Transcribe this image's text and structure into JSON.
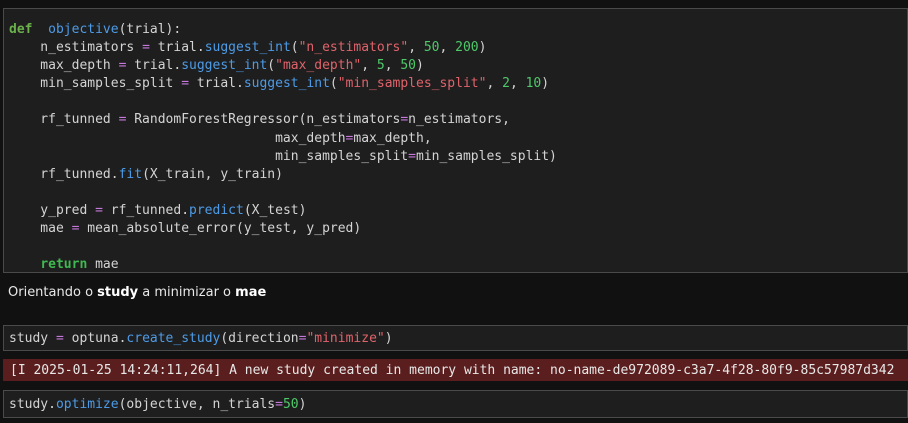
{
  "cell1": {
    "lines": [
      [
        [
          "kw-def",
          "def"
        ],
        [
          "",
          "  "
        ],
        [
          "fn",
          "objective"
        ],
        [
          "",
          "(trial):"
        ]
      ],
      [
        [
          "",
          "    n_estimators "
        ],
        [
          "op",
          "="
        ],
        [
          "",
          " trial."
        ],
        [
          "fn",
          "suggest_int"
        ],
        [
          "",
          "("
        ],
        [
          "str",
          "\"n_estimators\""
        ],
        [
          "",
          ", "
        ],
        [
          "num",
          "50"
        ],
        [
          "",
          ", "
        ],
        [
          "num",
          "200"
        ],
        [
          "",
          ")"
        ]
      ],
      [
        [
          "",
          "    max_depth "
        ],
        [
          "op",
          "="
        ],
        [
          "",
          " trial."
        ],
        [
          "fn",
          "suggest_int"
        ],
        [
          "",
          "("
        ],
        [
          "str",
          "\"max_depth\""
        ],
        [
          "",
          ", "
        ],
        [
          "num",
          "5"
        ],
        [
          "",
          ", "
        ],
        [
          "num",
          "50"
        ],
        [
          "",
          ")"
        ]
      ],
      [
        [
          "",
          "    min_samples_split "
        ],
        [
          "op",
          "="
        ],
        [
          "",
          " trial."
        ],
        [
          "fn",
          "suggest_int"
        ],
        [
          "",
          "("
        ],
        [
          "str",
          "\"min_samples_split\""
        ],
        [
          "",
          ", "
        ],
        [
          "num",
          "2"
        ],
        [
          "",
          ", "
        ],
        [
          "num",
          "10"
        ],
        [
          "",
          ")"
        ]
      ],
      [
        [
          "",
          ""
        ]
      ],
      [
        [
          "",
          "    rf_tunned "
        ],
        [
          "op",
          "="
        ],
        [
          "",
          " RandomForestRegressor(n_estimators"
        ],
        [
          "op",
          "="
        ],
        [
          "",
          "n_estimators,"
        ]
      ],
      [
        [
          "",
          "                                  max_depth"
        ],
        [
          "op",
          "="
        ],
        [
          "",
          "max_depth,"
        ]
      ],
      [
        [
          "",
          "                                  min_samples_split"
        ],
        [
          "op",
          "="
        ],
        [
          "",
          "min_samples_split)"
        ]
      ],
      [
        [
          "",
          "    rf_tunned."
        ],
        [
          "fn",
          "fit"
        ],
        [
          "",
          "(X_train, y_train)"
        ]
      ],
      [
        [
          "",
          ""
        ]
      ],
      [
        [
          "",
          "    y_pred "
        ],
        [
          "op",
          "="
        ],
        [
          "",
          " rf_tunned."
        ],
        [
          "fn",
          "predict"
        ],
        [
          "",
          "(X_test)"
        ]
      ],
      [
        [
          "",
          "    mae "
        ],
        [
          "op",
          "="
        ],
        [
          "",
          " mean_absolute_error(y_test, y_pred)"
        ]
      ],
      [
        [
          "",
          ""
        ]
      ],
      [
        [
          "",
          "    "
        ],
        [
          "kw-ret",
          "return"
        ],
        [
          "",
          " mae"
        ]
      ]
    ]
  },
  "markdown": {
    "prefix": "Orientando o ",
    "bold1": "study",
    "middle": " a minimizar o ",
    "bold2": "mae"
  },
  "cell2": {
    "lines": [
      [
        [
          "",
          "study "
        ],
        [
          "op",
          "="
        ],
        [
          "",
          " optuna."
        ],
        [
          "fn",
          "create_study"
        ],
        [
          "",
          "(direction"
        ],
        [
          "op",
          "="
        ],
        [
          "str",
          "\"minimize\""
        ],
        [
          "",
          ")"
        ]
      ]
    ]
  },
  "output": {
    "text": "[I 2025-01-25 14:24:11,264] A new study created in memory with name: no-name-de972089-c3a7-4f28-80f9-85c57987d342"
  },
  "cell3": {
    "lines": [
      [
        [
          "",
          "study."
        ],
        [
          "fn",
          "optimize"
        ],
        [
          "",
          "(objective, n_trials"
        ],
        [
          "op",
          "="
        ],
        [
          "num",
          "50"
        ],
        [
          "",
          ")"
        ]
      ]
    ]
  },
  "colors": {
    "keyword": "#6ab04c",
    "function": "#4d9be6",
    "string": "#e0636b",
    "number": "#4ec96a",
    "operator": "#c678dd",
    "error_bg": "#5a1e1e"
  }
}
